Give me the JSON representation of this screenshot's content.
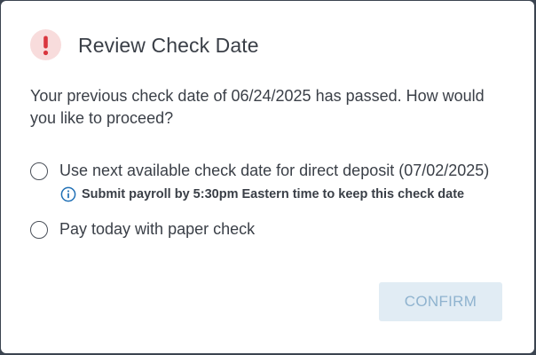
{
  "dialog": {
    "title": "Review Check Date",
    "message": "Your previous check date of 06/24/2025 has passed. How would you like to proceed?",
    "options": [
      {
        "label": "Use next available check date for direct deposit (07/02/2025)",
        "selected": false
      },
      {
        "label": "Pay today with paper check",
        "selected": false
      }
    ],
    "hint": "Submit payroll by 5:30pm Eastern time to keep this check date",
    "confirm_label": "CONFIRM",
    "confirm_disabled": true
  },
  "icons": {
    "header": "exclamation-icon",
    "hint": "info-icon"
  },
  "colors": {
    "alert_red": "#d9363e",
    "alert_bg": "#f8dcdc",
    "info_blue": "#1f6fb5",
    "text": "#3a3f47",
    "button_bg_disabled": "#e1ecf4",
    "button_text_disabled": "#8fb3cf"
  }
}
